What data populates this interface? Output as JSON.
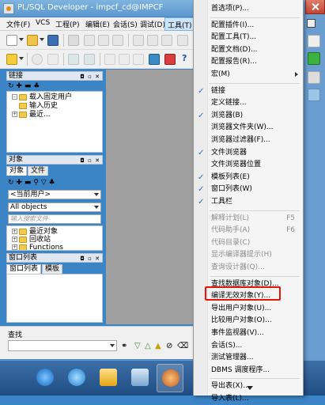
{
  "window": {
    "title": "PL/SQL Developer - impcf_cd@IMPCF"
  },
  "menubar": [
    {
      "label": "文件(F)"
    },
    {
      "label": "VCS"
    },
    {
      "label": "工程(P)"
    },
    {
      "label": "编辑(E)"
    },
    {
      "label": "会话(S)"
    },
    {
      "label": "调试(D)"
    },
    {
      "label": "工具(T)"
    }
  ],
  "panes": {
    "connections": {
      "title": "链接",
      "tree": [
        {
          "label": "载入固定用户"
        },
        {
          "label": "输入历史"
        },
        {
          "label": "最近..."
        }
      ]
    },
    "objects": {
      "title": "对象",
      "tabs": [
        "对象",
        "文件"
      ],
      "owner_combo": "<当前用户>",
      "filter_combo": "All objects",
      "search_placeholder": "输入搜索文件",
      "tree": [
        {
          "label": "最近对象"
        },
        {
          "label": "回收站"
        },
        {
          "label": "Functions"
        }
      ]
    },
    "window_list": {
      "title": "窗口列表",
      "tabs": [
        "窗口列表",
        "模板"
      ]
    }
  },
  "find_bar": {
    "label": "查找"
  },
  "tools_menu": {
    "items": [
      {
        "label": "首选项(P)...",
        "checked": false,
        "disabled": false
      },
      {
        "sep": true
      },
      {
        "label": "配置插件(I)...",
        "checked": false,
        "disabled": false
      },
      {
        "label": "配置工具(T)...",
        "checked": false,
        "disabled": false
      },
      {
        "label": "配置文档(D)...",
        "checked": false,
        "disabled": false
      },
      {
        "label": "配置报告(R)...",
        "checked": false,
        "disabled": false
      },
      {
        "label": "宏(M)",
        "submenu": true,
        "checked": false,
        "disabled": false
      },
      {
        "sep": true
      },
      {
        "label": "链接",
        "checked": true,
        "disabled": false
      },
      {
        "label": "定义链接...",
        "checked": false,
        "disabled": false
      },
      {
        "label": "浏览器(B)",
        "checked": true,
        "disabled": false
      },
      {
        "label": "浏览器文件夹(W)...",
        "checked": false,
        "disabled": false
      },
      {
        "label": "浏览器过滤器(F)...",
        "checked": false,
        "disabled": false
      },
      {
        "label": "文件浏览器",
        "checked": true,
        "disabled": false
      },
      {
        "label": "文件浏览器位置",
        "checked": false,
        "disabled": false
      },
      {
        "label": "模板列表(E)",
        "checked": true,
        "disabled": false
      },
      {
        "label": "窗口列表(W)",
        "checked": true,
        "disabled": false
      },
      {
        "label": "工具栏",
        "checked": true,
        "disabled": false
      },
      {
        "sep": true
      },
      {
        "label": "解释计划(L)",
        "shortcut": "F5",
        "checked": false,
        "disabled": true
      },
      {
        "label": "代码助手(A)",
        "shortcut": "F6",
        "checked": false,
        "disabled": true
      },
      {
        "label": "代码目录(C)",
        "checked": false,
        "disabled": true
      },
      {
        "label": "显示编译器提示(H)",
        "checked": false,
        "disabled": true
      },
      {
        "label": "查询设计器(Q)...",
        "checked": false,
        "disabled": true
      },
      {
        "sep": true
      },
      {
        "label": "查找数据库对象(D)...",
        "checked": false,
        "disabled": false
      },
      {
        "label": "编译无效对象(Y)...",
        "checked": false,
        "disabled": false
      },
      {
        "label": "导出用户对象(U)...",
        "checked": false,
        "disabled": false,
        "highlighted": true
      },
      {
        "label": "比较用户对象(O)...",
        "checked": false,
        "disabled": false
      },
      {
        "label": "事件监视器(V)...",
        "checked": false,
        "disabled": false
      },
      {
        "label": "会话(S)...",
        "checked": false,
        "disabled": false
      },
      {
        "label": "测试管理器...",
        "checked": false,
        "disabled": false
      },
      {
        "label": "DBMS 调度程序...",
        "checked": false,
        "disabled": false
      },
      {
        "sep": true
      },
      {
        "label": "导出表(X)...",
        "checked": false,
        "disabled": false
      },
      {
        "label": "导入表(L)...",
        "checked": false,
        "disabled": false
      }
    ]
  },
  "colors": {
    "highlight_box": "#e8120c",
    "taskbar": "#1f4d83",
    "check": "#2a6fc9"
  }
}
